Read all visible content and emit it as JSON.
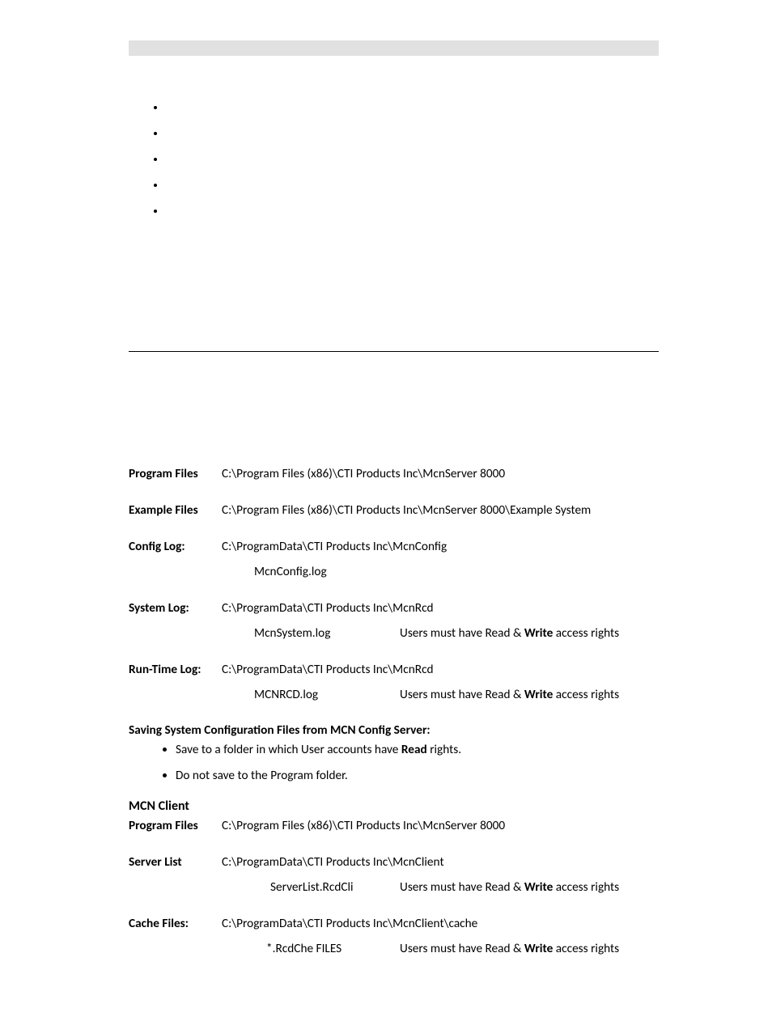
{
  "server": {
    "programFiles": {
      "label": "Program Files",
      "path": "C:\\Program Files (x86)\\CTI Products Inc\\McnServer 8000"
    },
    "exampleFiles": {
      "label": "Example Files",
      "path": "C:\\Program Files (x86)\\CTI Products Inc\\McnServer 8000\\Example System"
    },
    "configLog": {
      "label": "Config Log:",
      "path": "C:\\ProgramData\\CTI Products Inc\\McnConfig",
      "file": "McnConfig.log"
    },
    "systemLog": {
      "label": "System Log:",
      "path": "C:\\ProgramData\\CTI Products Inc\\McnRcd",
      "file": "McnSystem.log",
      "rightsA": "Users must have Read & ",
      "rightsB": "Write",
      "rightsC": " access rights"
    },
    "runtimeLog": {
      "label": "Run-Time Log:",
      "path": "C:\\ProgramData\\CTI Products Inc\\McnRcd",
      "file": "MCNRCD.log",
      "rightsA": "Users must have Read & ",
      "rightsB": "Write",
      "rightsC": " access rights"
    }
  },
  "saving": {
    "heading": "Saving System Configuration Files from MCN Config Server:",
    "b1a": "Save to a folder in which User accounts have ",
    "b1b": "Read",
    "b1c": " rights.",
    "b2": "Do not save to the Program folder."
  },
  "client": {
    "heading": "MCN Client",
    "programFiles": {
      "label": "Program Files",
      "path": "C:\\Program Files (x86)\\CTI Products Inc\\McnServer 8000"
    },
    "serverList": {
      "label": "Server List",
      "path": "C:\\ProgramData\\CTI Products Inc\\McnClient",
      "file": "ServerList.RcdCli",
      "rightsA": "Users must have Read & ",
      "rightsB": "Write",
      "rightsC": " access rights"
    },
    "cacheFiles": {
      "label": "Cache Files:",
      "path": "C:\\ProgramData\\CTI Products Inc\\McnClient\\cache",
      "file": "*.RcdChe FILES",
      "rightsA": "Users must have Read & ",
      "rightsB": "Write",
      "rightsC": " access rights"
    }
  }
}
